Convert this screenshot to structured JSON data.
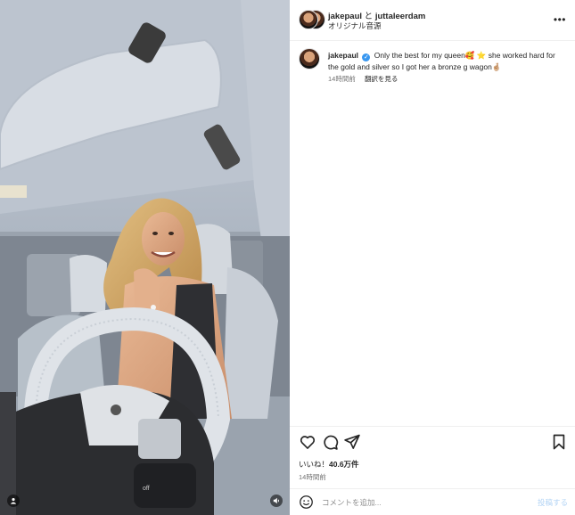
{
  "header": {
    "user1": "jakepaul",
    "connector": "と",
    "user2": "juttaleerdam",
    "audio": "オリジナル音源",
    "more_icon": "more-horizontal-icon"
  },
  "caption": {
    "username": "jakepaul",
    "text": "Only the best for my queen🥰 ⭐ she worked hard for the gold and silver so I got her a bronze g wagon🤞🏼",
    "time": "14時間前",
    "translate": "翻訳を見る"
  },
  "actions": {
    "like_icon": "heart-icon",
    "comment_icon": "comment-icon",
    "share_icon": "paper-plane-icon",
    "save_icon": "bookmark-icon"
  },
  "likes": {
    "label": "いいね！",
    "count": "40.6万件"
  },
  "posted_ago": "14時間前",
  "comment": {
    "placeholder": "コメントを追加...",
    "post_label": "投稿する"
  },
  "media": {
    "user_tag_icon": "user-icon",
    "mute_icon": "speaker-icon"
  },
  "colors": {
    "verified": "#3897f0",
    "post_button_disabled": "#b3d4f5",
    "secondary_text": "#737373"
  }
}
